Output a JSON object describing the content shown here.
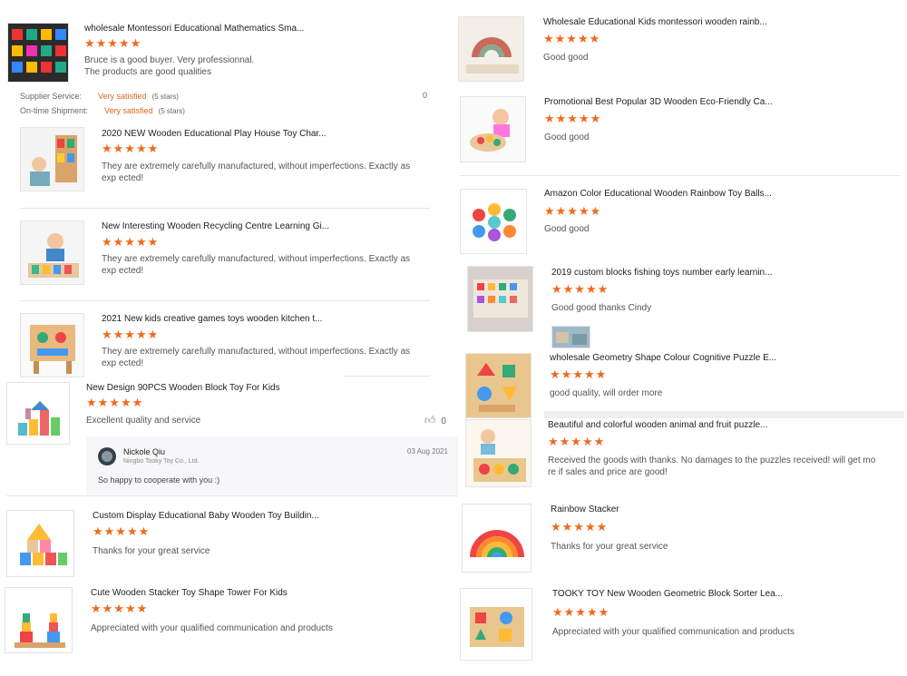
{
  "colors": {
    "star": "#ef6a1c",
    "accent": "#e0661c",
    "divider": "#e6e6e6"
  },
  "star_icons": "★★★★★",
  "left_reviews": [
    {
      "title": "wholesale Montessori Educational Mathematics Sma...",
      "text": "Bruce is a good buyer. Very professionnal.\nThe products are good qualities",
      "rating": 5
    },
    {
      "title": "2020 NEW Wooden Educational Play House Toy Char...",
      "text": "They are extremely carefully manufactured, without imperfections. Exactly as exp ected!",
      "rating": 5
    },
    {
      "title": "New Interesting Wooden Recycling Centre Learning Gi...",
      "text": "They are extremely carefully manufactured, without imperfections. Exactly as exp ected!",
      "rating": 5
    },
    {
      "title": "2021 New kids creative games toys wooden kitchen t...",
      "text": "They are extremely carefully manufactured, without imperfections. Exactly as exp ected!",
      "rating": 5
    },
    {
      "title": "New Design 90PCS Wooden Block Toy For Kids",
      "text": "Excellent quality and service",
      "rating": 5
    },
    {
      "title": "Custom Display Educational Baby Wooden Toy Buildin...",
      "text": "Thanks for your great service",
      "rating": 5
    },
    {
      "title": "Cute Wooden Stacker Toy Shape Tower For Kids",
      "text": "Appreciated with your qualified communication and products",
      "rating": 5
    }
  ],
  "supplier_ratings": [
    {
      "label": "Supplier Service:",
      "value": "Very satisfied",
      "note": "(5 stars)"
    },
    {
      "label": "On-time Shipment:",
      "value": "Very satisfied",
      "note": "(5 stars)"
    }
  ],
  "partial_count": "0",
  "like_count": "0",
  "reply": {
    "name": "Nickole Qiu",
    "company": "Ningbo Tooky Toy Co., Ltd.",
    "date": "03 Aug 2021",
    "text": "So happy to cooperate with you  :)"
  },
  "right_reviews": [
    {
      "title": "Wholesale Educational Kids montessori wooden rainb...",
      "text": "Good good",
      "rating": 5
    },
    {
      "title": "Promotional Best Popular 3D Wooden Eco-Friendly Ca...",
      "text": "Good good",
      "rating": 5
    },
    {
      "title": "Amazon Color Educational Wooden Rainbow Toy Balls...",
      "text": "Good good",
      "rating": 5
    },
    {
      "title": "2019 custom blocks fishing toys number early learnin...",
      "text": "Good good thanks Cindy",
      "rating": 5
    },
    {
      "title": "wholesale Geometry Shape Colour Cognitive Puzzle E...",
      "text": "good quality, will order more",
      "rating": 5
    },
    {
      "title": "Beautiful and colorful wooden animal and fruit puzzle...",
      "text": "Received the goods with thanks. No damages to the puzzles received! will get mo re if sales and price are good!",
      "rating": 5
    },
    {
      "title": "Rainbow Stacker",
      "text": "Thanks for your great service",
      "rating": 5
    },
    {
      "title": "TOOKY TOY New Wooden Geometric Block Sorter Lea...",
      "text": "Appreciated with your qualified communication and products",
      "rating": 5
    }
  ]
}
